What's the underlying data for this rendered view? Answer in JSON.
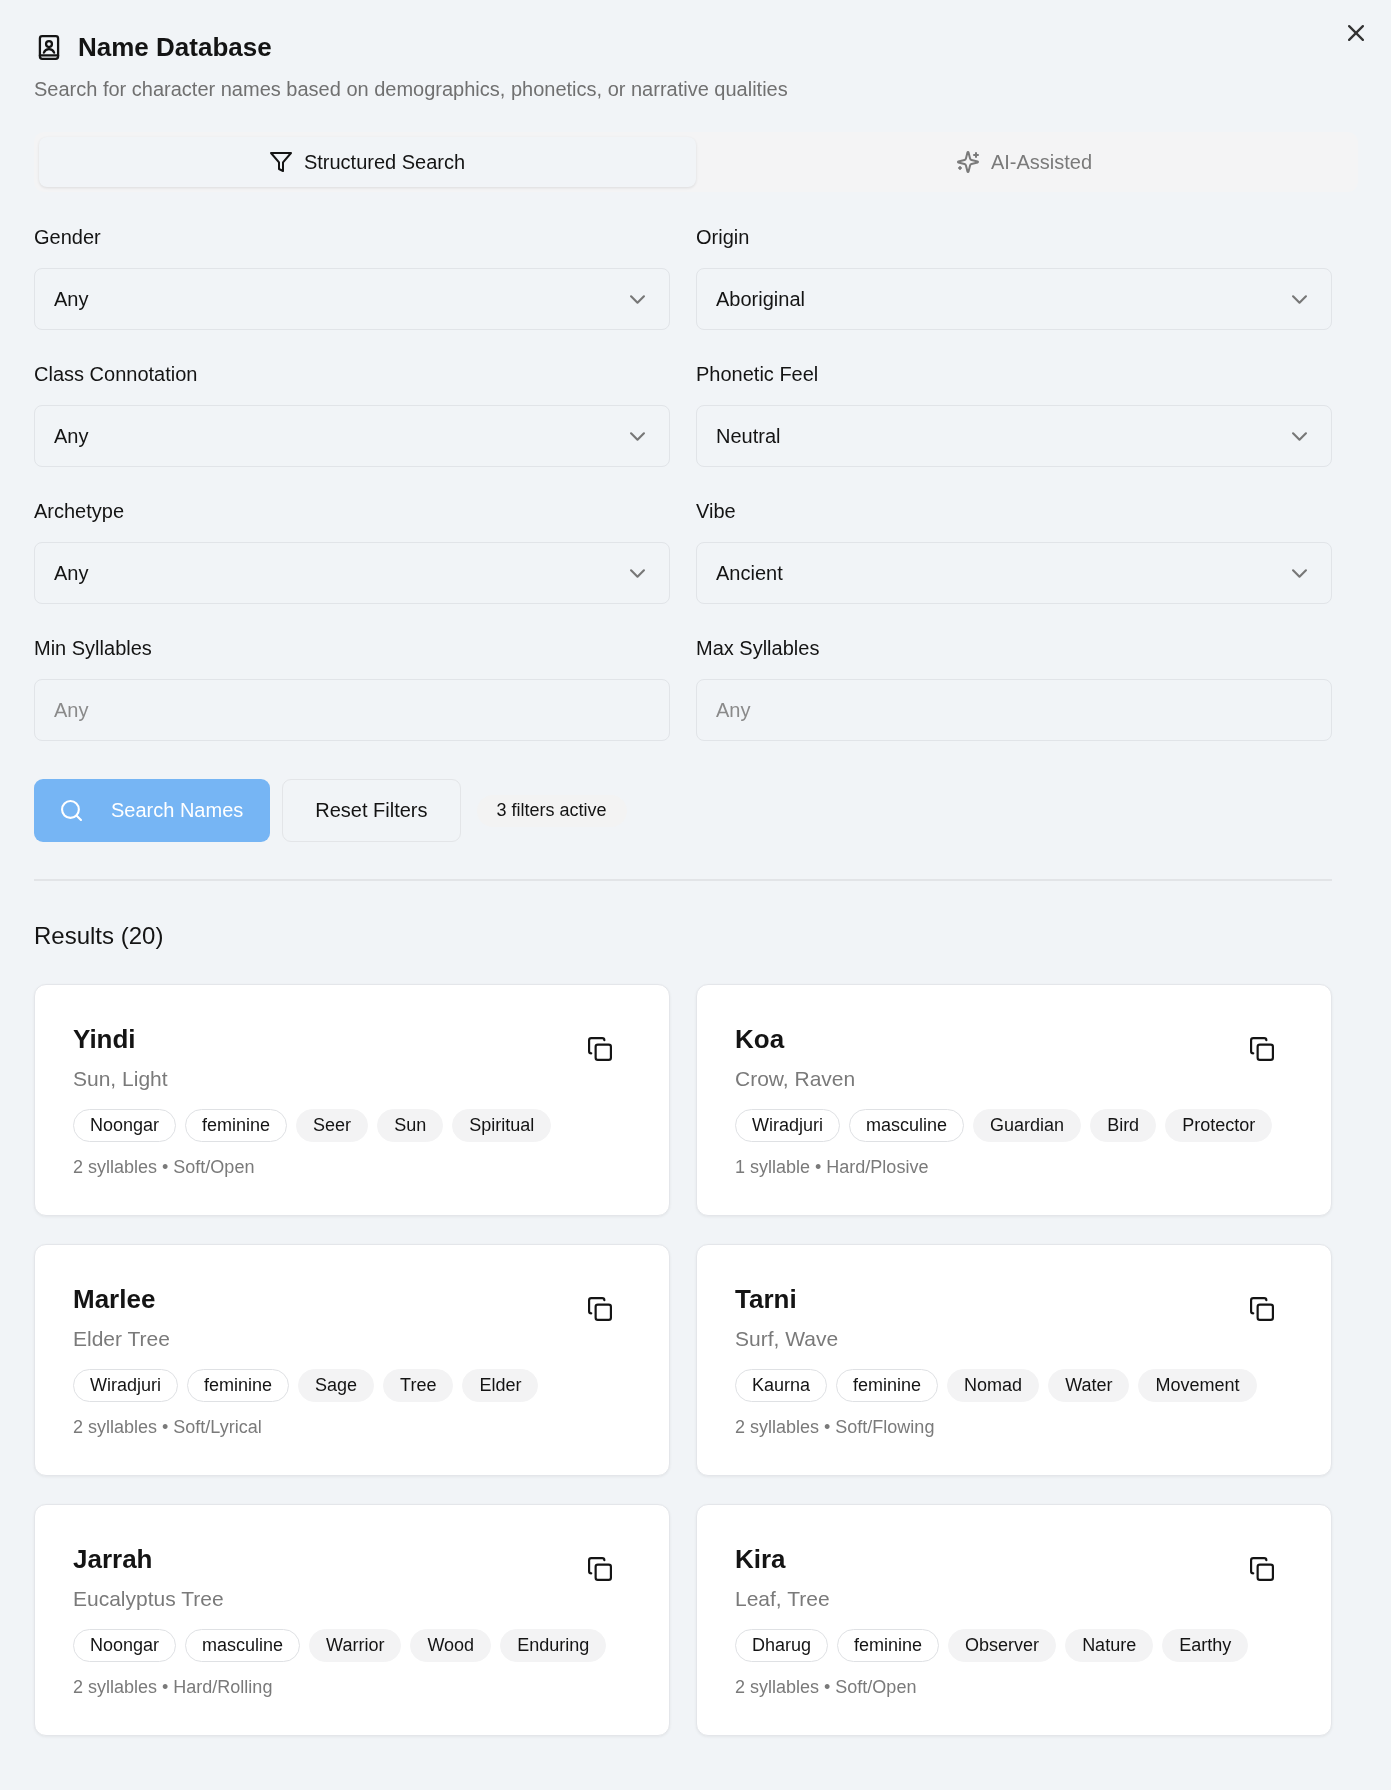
{
  "dialog": {
    "title": "Name Database",
    "subtitle": "Search for character names based on demographics, phonetics, or narrative qualities"
  },
  "tabs": [
    {
      "label": "Structured Search",
      "selected": true
    },
    {
      "label": "AI-Assisted",
      "selected": false
    }
  ],
  "filters": [
    {
      "label": "Gender",
      "kind": "select",
      "value": "Any"
    },
    {
      "label": "Origin",
      "kind": "select",
      "value": "Aboriginal"
    },
    {
      "label": "Class Connotation",
      "kind": "select",
      "value": "Any"
    },
    {
      "label": "Phonetic Feel",
      "kind": "select",
      "value": "Neutral"
    },
    {
      "label": "Archetype",
      "kind": "select",
      "value": "Any"
    },
    {
      "label": "Vibe",
      "kind": "select",
      "value": "Ancient"
    },
    {
      "label": "Min Syllables",
      "kind": "input",
      "placeholder": "Any"
    },
    {
      "label": "Max Syllables",
      "kind": "input",
      "placeholder": "Any"
    }
  ],
  "buttons": [
    {
      "label": "Search Names",
      "kind": "primary"
    },
    {
      "label": "Reset Filters",
      "kind": "secondary"
    }
  ],
  "active_filters": "3 filters active",
  "results": {
    "heading": "Results (20)",
    "items": [
      {
        "name": "Yindi",
        "meaning": "Sun, Light",
        "origin": "Noongar",
        "gender": "feminine",
        "traits": [
          "Seer",
          "Sun",
          "Spiritual"
        ],
        "details": "2 syllables • Soft/Open"
      },
      {
        "name": "Koa",
        "meaning": "Crow, Raven",
        "origin": "Wiradjuri",
        "gender": "masculine",
        "traits": [
          "Guardian",
          "Bird",
          "Protector"
        ],
        "details": "1 syllable • Hard/Plosive"
      },
      {
        "name": "Marlee",
        "meaning": "Elder Tree",
        "origin": "Wiradjuri",
        "gender": "feminine",
        "traits": [
          "Sage",
          "Tree",
          "Elder"
        ],
        "details": "2 syllables • Soft/Lyrical"
      },
      {
        "name": "Tarni",
        "meaning": "Surf, Wave",
        "origin": "Kaurna",
        "gender": "feminine",
        "traits": [
          "Nomad",
          "Water",
          "Movement"
        ],
        "details": "2 syllables • Soft/Flowing"
      },
      {
        "name": "Jarrah",
        "meaning": "Eucalyptus Tree",
        "origin": "Noongar",
        "gender": "masculine",
        "traits": [
          "Warrior",
          "Wood",
          "Enduring"
        ],
        "details": "2 syllables • Hard/Rolling"
      },
      {
        "name": "Kira",
        "meaning": "Leaf, Tree",
        "origin": "Dharug",
        "gender": "feminine",
        "traits": [
          "Observer",
          "Nature",
          "Earthy"
        ],
        "details": "2 syllables • Soft/Open"
      }
    ]
  }
}
